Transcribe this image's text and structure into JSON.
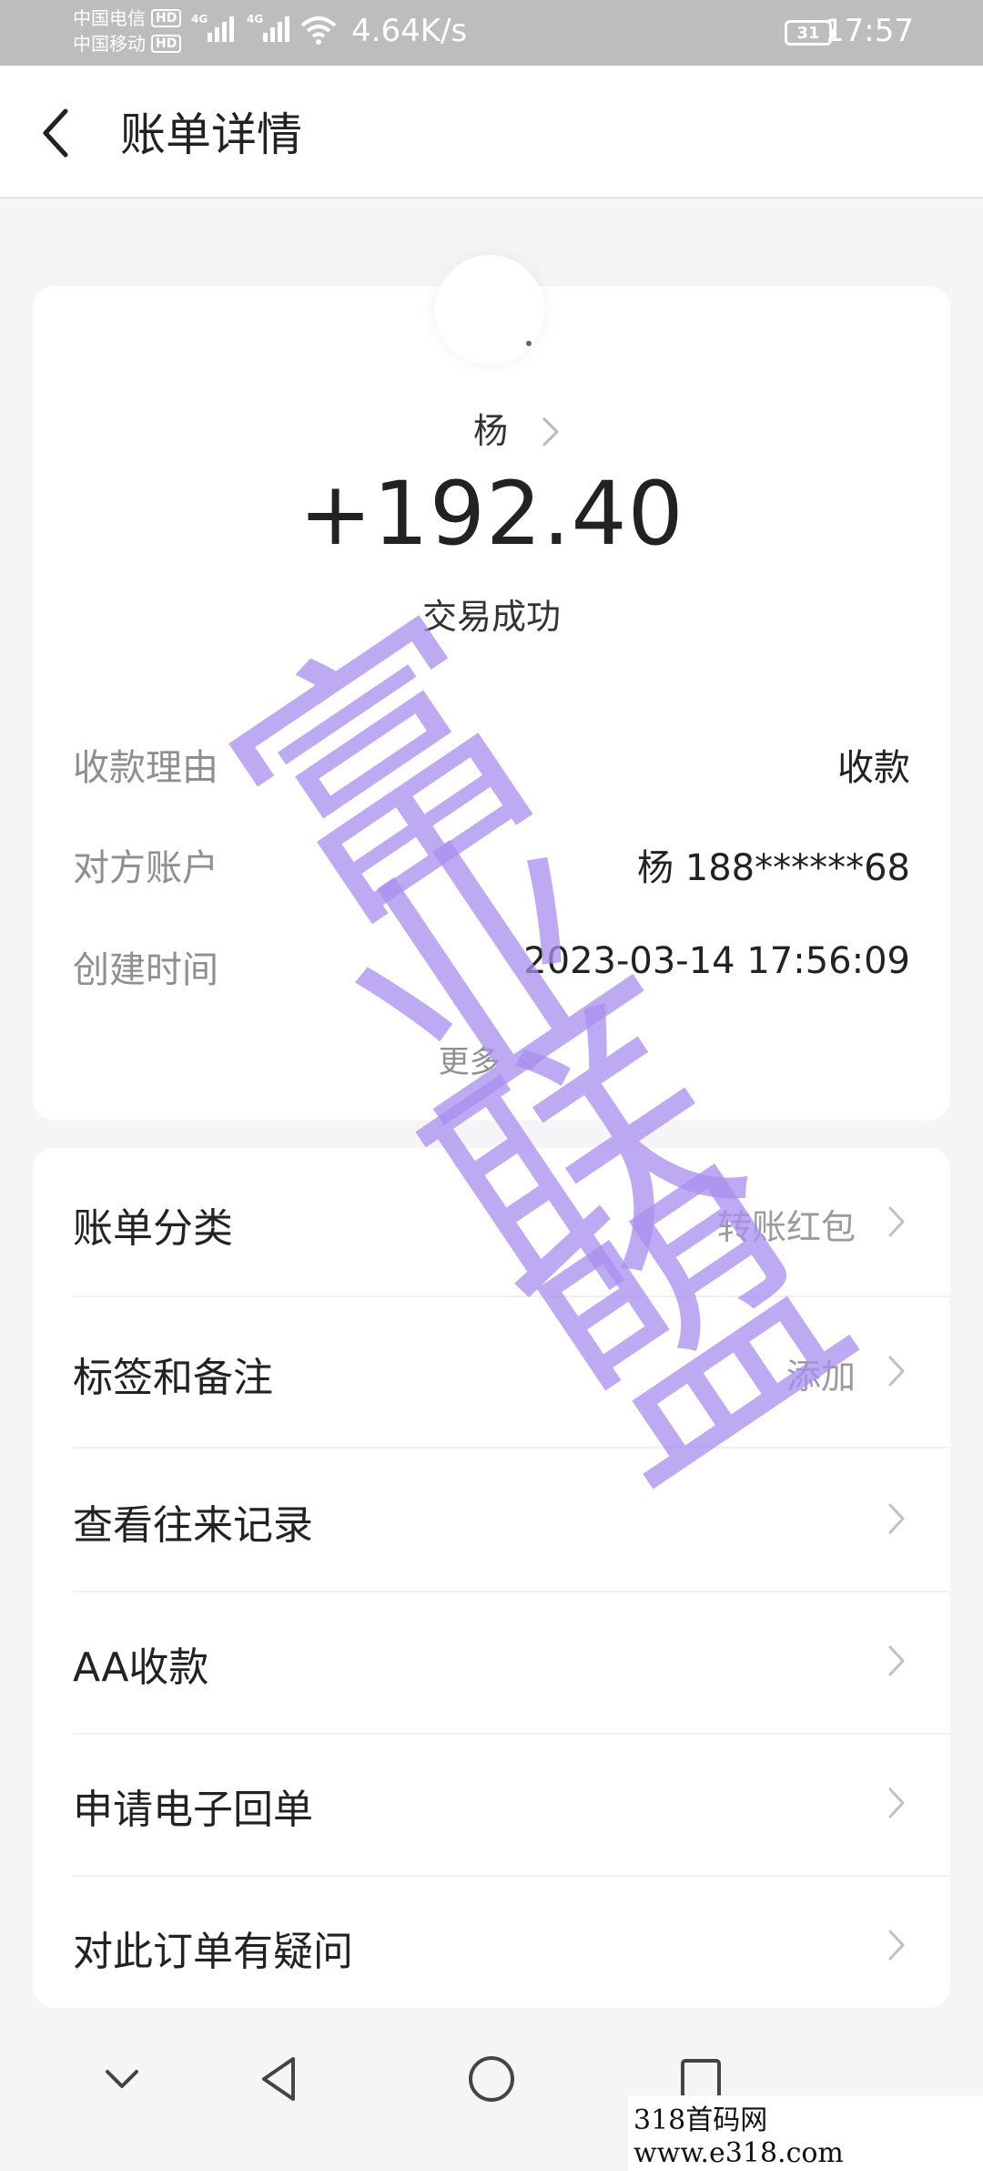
{
  "status_bar": {
    "carrier1": "中国电信",
    "carrier2": "中国移动",
    "hd": "HD",
    "net1": "4G",
    "net2": "4G",
    "speed": "4.64K/s",
    "battery": "31",
    "time": "17:57"
  },
  "header": {
    "title": "账单详情"
  },
  "summary": {
    "payer_name": "杨",
    "amount": "+192.40",
    "status": "交易成功",
    "fields": [
      {
        "key": "收款理由",
        "value": "收款"
      },
      {
        "key": "对方账户",
        "value": "杨 188******68"
      },
      {
        "key": "创建时间",
        "value": "2023-03-14 17:56:09"
      }
    ],
    "more_label": "更多"
  },
  "actions": [
    {
      "label": "账单分类",
      "value": "转账红包"
    },
    {
      "label": "标签和备注",
      "value": "添加"
    },
    {
      "label": "查看往来记录",
      "value": ""
    },
    {
      "label": "AA收款",
      "value": ""
    },
    {
      "label": "申请电子回单",
      "value": ""
    },
    {
      "label": "对此订单有疑问",
      "value": ""
    }
  ],
  "watermark": {
    "chars": [
      "富",
      "业",
      "联",
      "盟"
    ]
  },
  "footer_watermark": "318首码网 www.e318.com",
  "colors": {
    "watermark": "#a98ef0",
    "muted": "#8e8e93",
    "text": "#222222"
  }
}
